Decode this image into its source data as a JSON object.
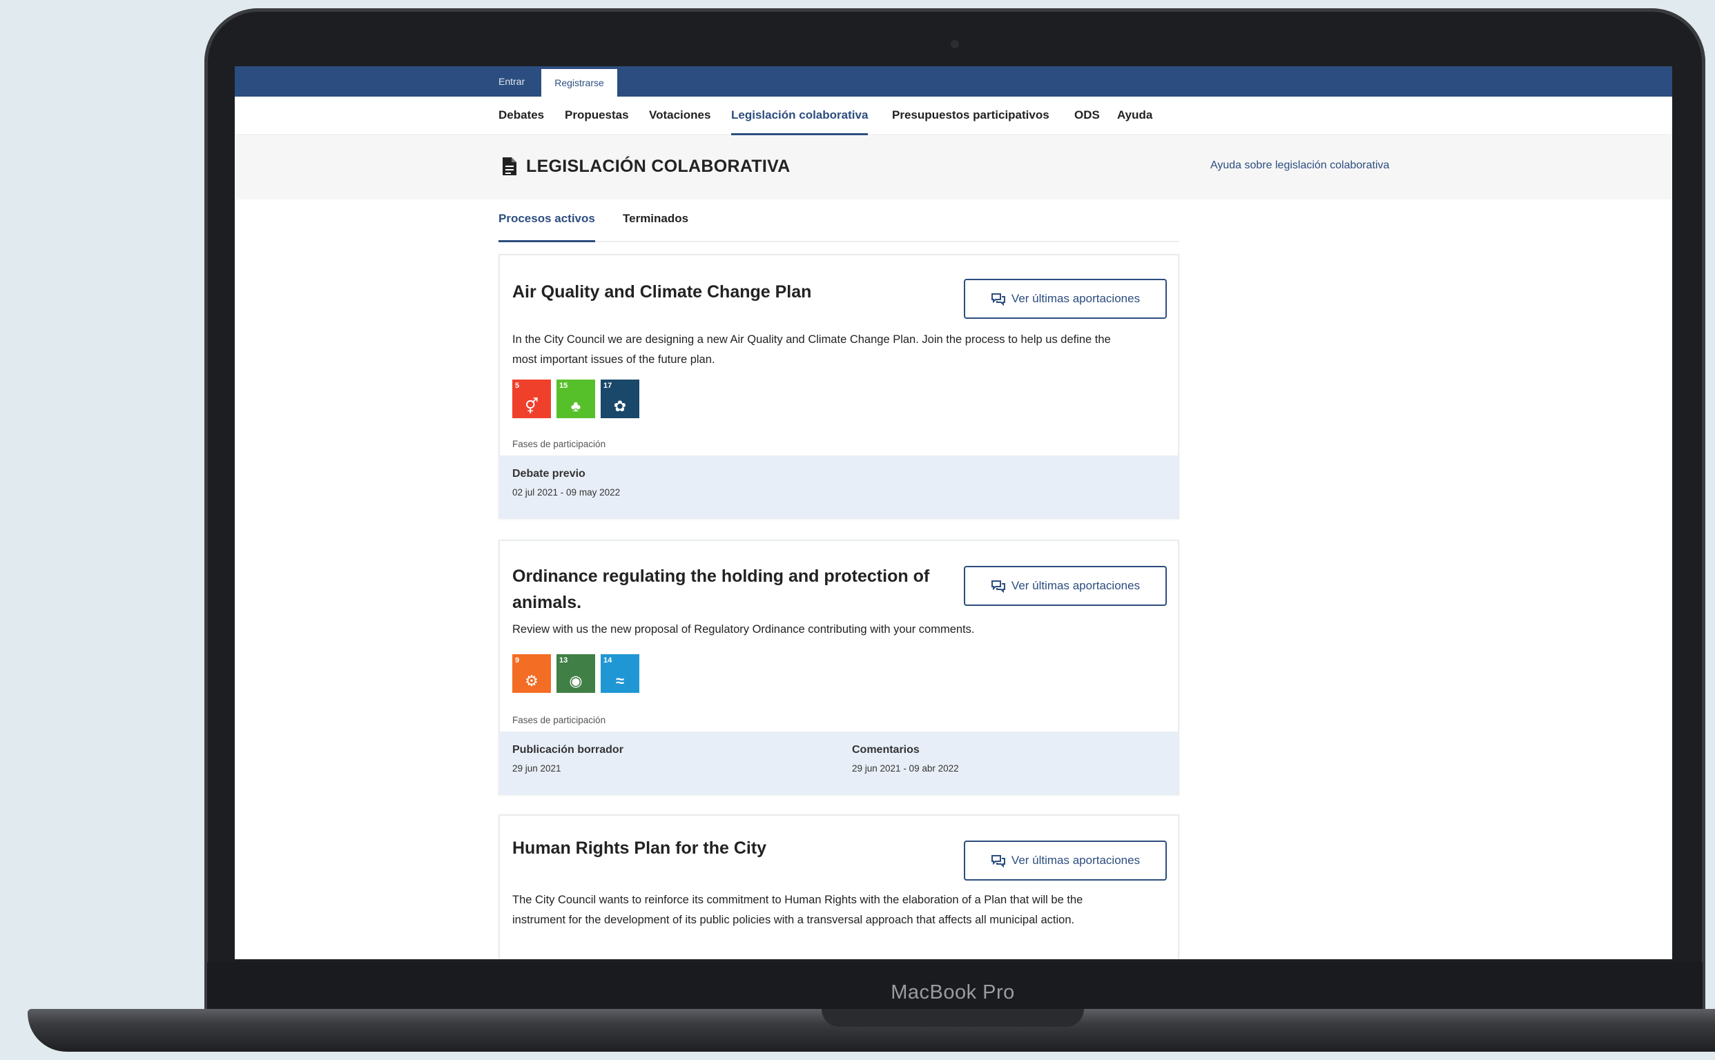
{
  "device": {
    "brand": "MacBook Pro"
  },
  "topbar": {
    "login": "Entrar",
    "register": "Registrarse"
  },
  "nav": {
    "items": [
      "Debates",
      "Propuestas",
      "Votaciones",
      "Legislación colaborativa",
      "Presupuestos participativos",
      "ODS",
      "Ayuda"
    ],
    "active": "Legislación colaborativa"
  },
  "header": {
    "title": "LEGISLACIÓN COLABORATIVA",
    "help_link": "Ayuda sobre legislación colaborativa"
  },
  "subtabs": {
    "active": "Procesos activos",
    "finished": "Terminados"
  },
  "colors": {
    "primary": "#2c4d7f",
    "phase_band": "#e8eef7",
    "header_bg": "#f6f6f6"
  },
  "processes": [
    {
      "title": "Air Quality and Climate Change Plan",
      "button": "Ver últimas aportaciones",
      "description": "In the City Council we are designing a new Air Quality and Climate Change Plan. Join the process to help us define the most important issues of the future plan.",
      "sdgs": [
        {
          "number": "5",
          "color": "#ef402b",
          "icon": "gender-equality-icon"
        },
        {
          "number": "15",
          "color": "#56c02b",
          "icon": "life-on-land-icon"
        },
        {
          "number": "17",
          "color": "#19486a",
          "icon": "partnerships-icon"
        }
      ],
      "phases_label": "Fases de participación",
      "phases": [
        {
          "name": "Debate previo",
          "dates": "02 jul 2021 - 09 may 2022"
        }
      ]
    },
    {
      "title": "Ordinance regulating the holding and protection of animals.",
      "button": "Ver últimas aportaciones",
      "description": "Review with us the new proposal of Regulatory Ordinance contributing with your comments.",
      "sdgs": [
        {
          "number": "9",
          "color": "#f36d25",
          "icon": "industry-innovation-icon"
        },
        {
          "number": "13",
          "color": "#407f46",
          "icon": "climate-action-icon"
        },
        {
          "number": "14",
          "color": "#1f97d4",
          "icon": "life-below-water-icon"
        }
      ],
      "phases_label": "Fases de participación",
      "phases": [
        {
          "name": "Publicación borrador",
          "dates": "29 jun 2021"
        },
        {
          "name": "Comentarios",
          "dates": "29 jun 2021 - 09 abr 2022"
        }
      ]
    },
    {
      "title": "Human Rights Plan for the City",
      "button": "Ver últimas aportaciones",
      "description": "The City Council wants to reinforce its commitment to Human Rights with the elaboration of a Plan that will be the instrument for the development of its public policies with a transversal approach that affects all municipal action."
    }
  ]
}
